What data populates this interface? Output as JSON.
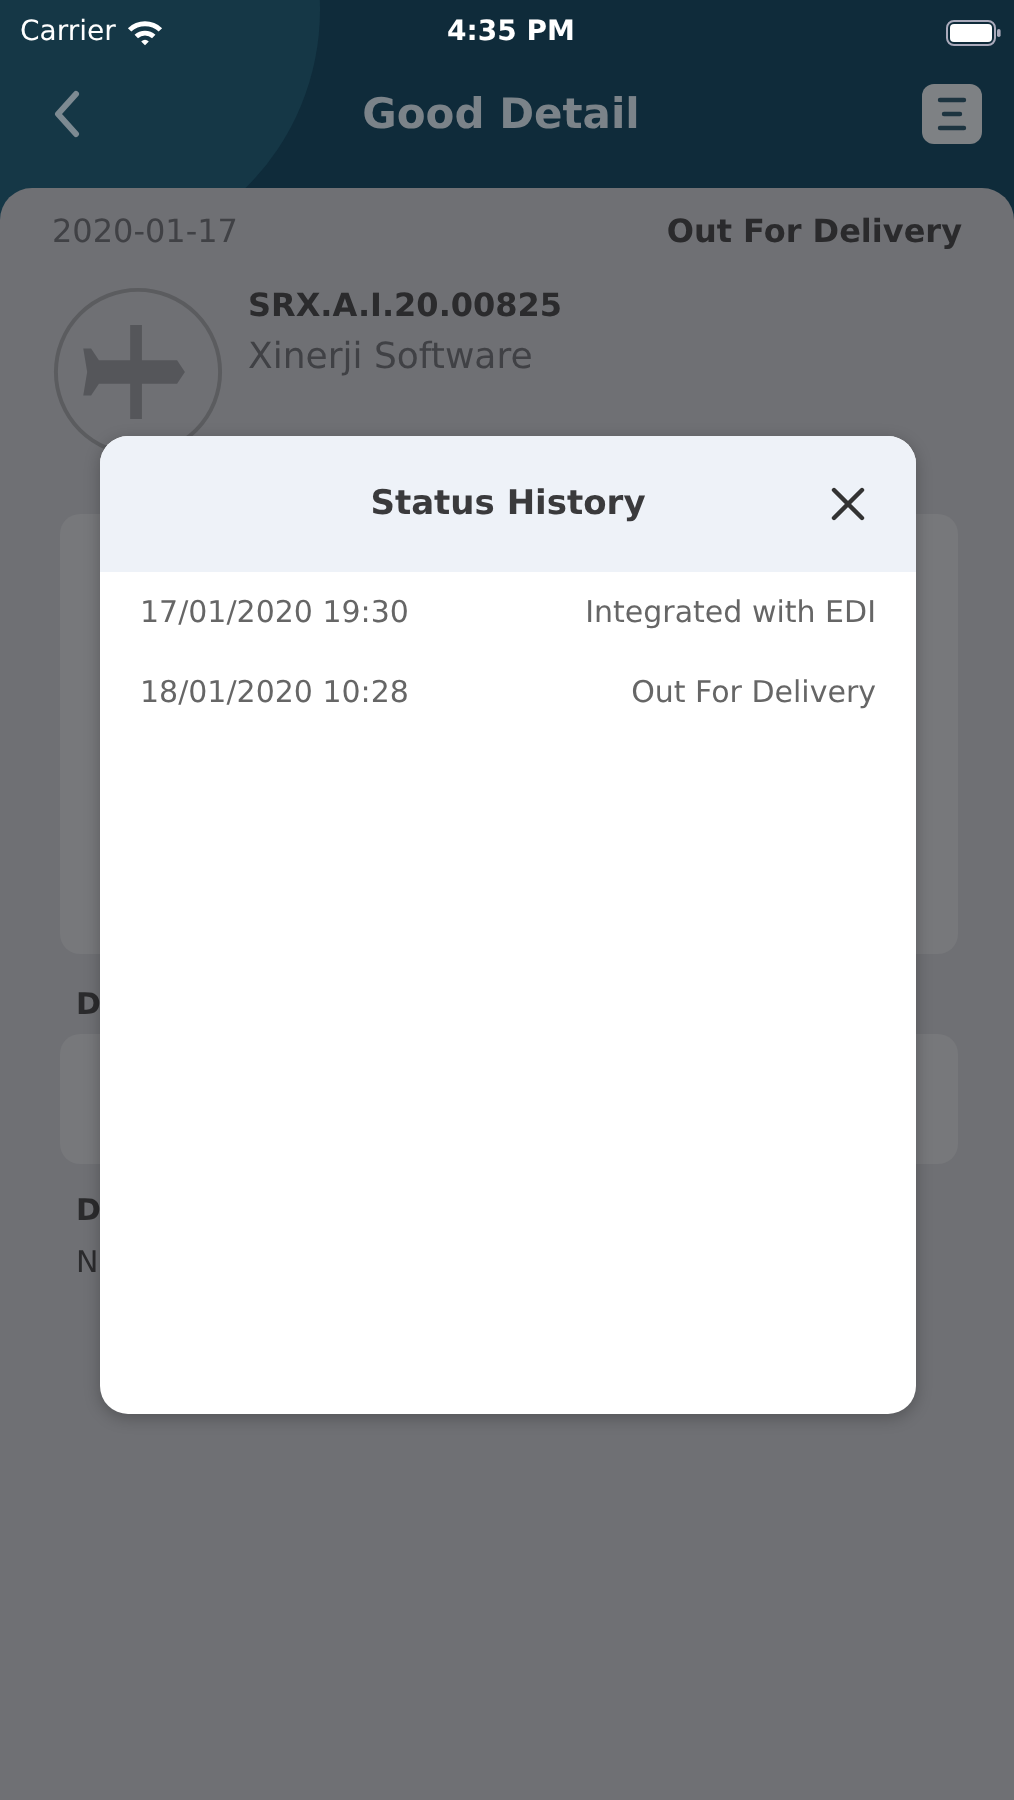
{
  "status_bar": {
    "carrier": "Carrier",
    "time": "4:35 PM"
  },
  "header": {
    "title": "Good Detail"
  },
  "shipment": {
    "date": "2020-01-17",
    "status": "Out For Delivery",
    "number": "SRX.A.I.20.00825",
    "company": "Xinerji Software"
  },
  "sections": [
    {
      "label": "D"
    },
    {
      "label": "D",
      "value": "N"
    }
  ],
  "modal": {
    "title": "Status History",
    "entries": [
      {
        "date": "17/01/2020 19:30",
        "status": "Integrated with EDI"
      },
      {
        "date": "18/01/2020 10:28",
        "status": "Out For Delivery"
      }
    ]
  }
}
